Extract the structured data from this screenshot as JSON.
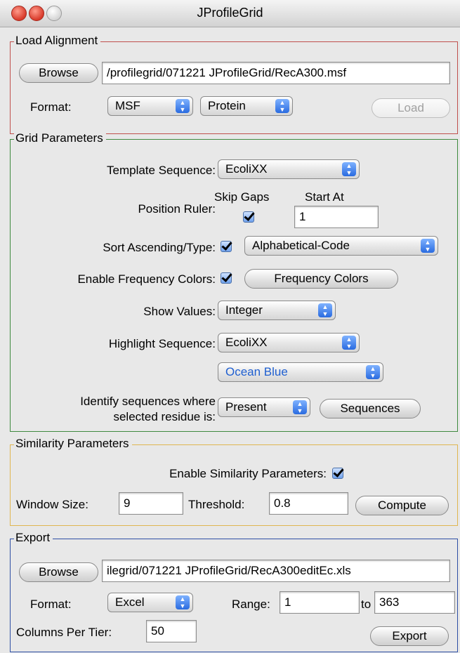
{
  "window": {
    "title": "JProfileGrid"
  },
  "load_alignment": {
    "legend": "Load Alignment",
    "browse_label": "Browse",
    "path_value": "/profilegrid/071221 JProfileGrid/RecA300.msf",
    "format_label": "Format:",
    "format_value": "MSF",
    "type_value": "Protein",
    "load_label": "Load"
  },
  "grid_parameters": {
    "legend": "Grid Parameters",
    "template_label": "Template Sequence:",
    "template_value": "EcoliXX",
    "skip_gaps_label": "Skip Gaps",
    "start_at_label": "Start At",
    "position_ruler_label": "Position Ruler:",
    "start_at_value": "1",
    "sort_label": "Sort Ascending/Type:",
    "sort_value": "Alphabetical-Code",
    "freq_label": "Enable Frequency Colors:",
    "freq_button": "Frequency Colors",
    "show_values_label": "Show Values:",
    "show_values_value": "Integer",
    "highlight_label": "Highlight Sequence:",
    "highlight_value": "EcoliXX",
    "color_value": "Ocean Blue",
    "identify_label_1": "Identify sequences where",
    "identify_label_2": "selected residue is:",
    "identify_value": "Present",
    "sequences_button": "Sequences"
  },
  "similarity": {
    "legend": "Similarity Parameters",
    "enable_label": "Enable Similarity Parameters:",
    "window_label": "Window Size:",
    "window_value": "9",
    "threshold_label": "Threshold:",
    "threshold_value": "0.8",
    "compute_label": "Compute"
  },
  "export": {
    "legend": "Export",
    "browse_label": "Browse",
    "path_value": "ilegrid/071221 JProfileGrid/RecA300editEc.xls",
    "format_label": "Format:",
    "format_value": "Excel",
    "range_label": "Range:",
    "range_from": "1",
    "to_label": "to",
    "range_to": "363",
    "columns_label": "Columns Per Tier:",
    "columns_value": "50",
    "export_label": "Export"
  },
  "colors": {
    "load_border": "#c0504d",
    "grid_border": "#3f8a3f",
    "similarity_border": "#e0b650",
    "export_border": "#2e4fa5"
  }
}
